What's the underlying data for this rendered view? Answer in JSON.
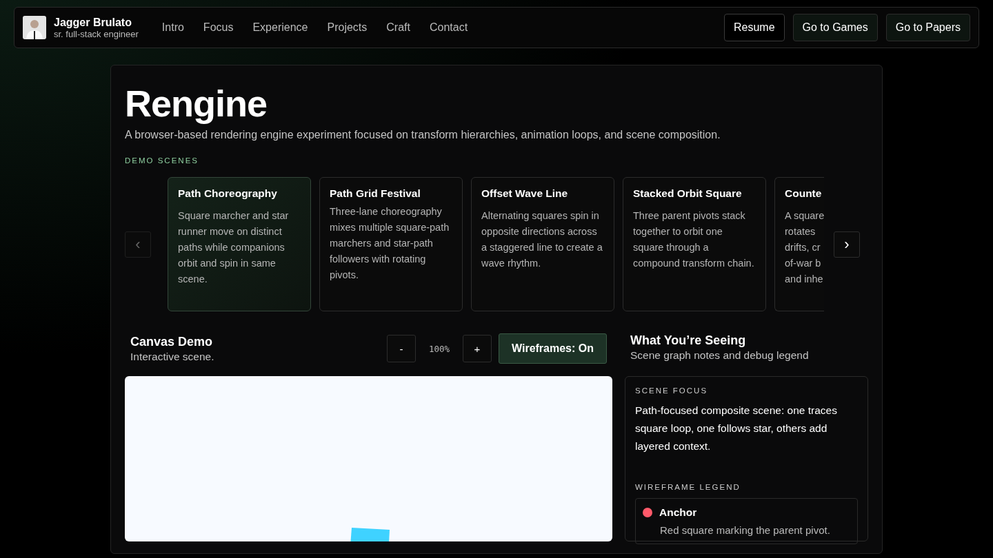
{
  "nav": {
    "name": "Jagger Brulato",
    "role": "sr. full-stack engineer",
    "links": [
      "Intro",
      "Focus",
      "Experience",
      "Projects",
      "Craft",
      "Contact"
    ],
    "buttons": [
      {
        "label": "Resume",
        "kind": "outline"
      },
      {
        "label": "Go to Games",
        "kind": "filled"
      },
      {
        "label": "Go to Papers",
        "kind": "filled"
      }
    ]
  },
  "hero": {
    "title": "Rengine",
    "subtitle": "A browser-based rendering engine experiment focused on transform hierarchies, animation loops, and scene composition."
  },
  "scenes": {
    "heading": "DEMO SCENES",
    "prev": "‹",
    "next": "›",
    "prev_disabled": true,
    "cards": [
      {
        "title": "Path Choreography",
        "description": "Square marcher and star runner move on distinct paths while companions orbit and spin in same scene.",
        "selected": true
      },
      {
        "title": "Path Grid Festival",
        "description": "Three-lane choreography mixes multiple square-path marchers and star-path followers with rotating pivots.",
        "selected": false
      },
      {
        "title": "Offset Wave Line",
        "description": "Alternating squares spin in opposite directions across a staggered line to create a wave rhythm.",
        "selected": false
      },
      {
        "title": "Stacked Orbit Square",
        "description": "Three parent pivots stack together to orbit one square through a compound transform chain.",
        "selected": false
      },
      {
        "title": "Counte",
        "lines": [
          "A square",
          "rotates",
          "drifts, cr",
          "of-war b",
          "and inhe"
        ],
        "selected": false
      }
    ]
  },
  "canvas": {
    "title": "Canvas Demo",
    "subtitle": "Interactive scene.",
    "zoom_out": "-",
    "zoom": "100%",
    "zoom_in": "+",
    "wireframes": {
      "label": "Wireframes: On",
      "on": true
    }
  },
  "notes": {
    "title": "What You’re Seeing",
    "subtitle": "Scene graph notes and debug legend",
    "focus_heading": "SCENE FOCUS",
    "focus_text": "Path-focused composite scene: one traces square loop, one follows star, others add layered context.",
    "legend_heading": "WIREFRAME LEGEND",
    "legend": [
      {
        "name": "Anchor",
        "color": "#ff5a6a",
        "description": "Red square marking the parent pivot."
      }
    ]
  }
}
